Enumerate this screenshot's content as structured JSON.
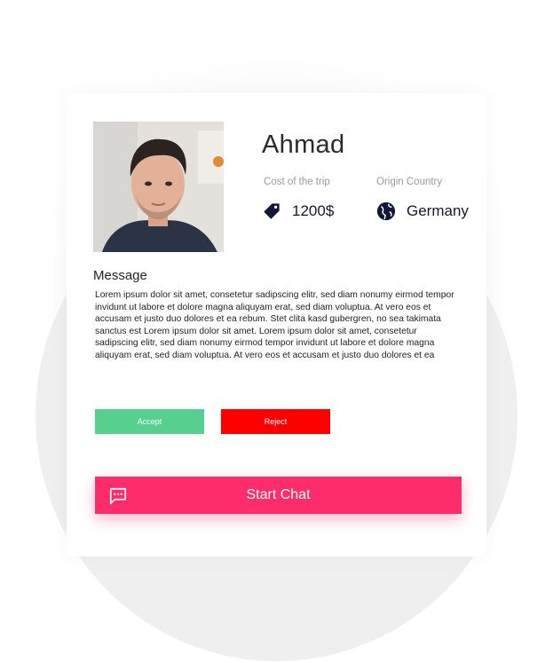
{
  "profile": {
    "name": "Ahmad",
    "cost_label": "Cost of the trip",
    "cost_value": "1200$",
    "origin_label": "Origin Country",
    "origin_value": "Germany"
  },
  "message": {
    "title": "Message",
    "body": "Lorem ipsum dolor sit amet, consetetur sadipscing elitr, sed diam nonumy eirmod tempor invidunt ut labore et dolore magna aliquyam erat, sed diam voluptua. At vero eos et accusam et justo duo dolores et ea rebum. Stet clita kasd gubergren, no sea takimata sanctus est Lorem ipsum dolor sit amet. Lorem ipsum dolor sit amet, consetetur sadipscing elitr, sed diam nonumy eirmod tempor invidunt ut labore et dolore magna aliquyam erat, sed diam voluptua. At vero eos et accusam et justo duo dolores et ea"
  },
  "actions": {
    "accept_label": "Accept",
    "reject_label": "Reject",
    "chat_label": "Start Chat"
  },
  "icons": {
    "price": "price-tag-icon",
    "country": "globe-icon",
    "chat": "chat-bubble-icon"
  },
  "colors": {
    "accept": "#56cf8f",
    "reject": "#ff0000",
    "chat": "#ff2c6b",
    "icon_dark": "#12173a"
  }
}
